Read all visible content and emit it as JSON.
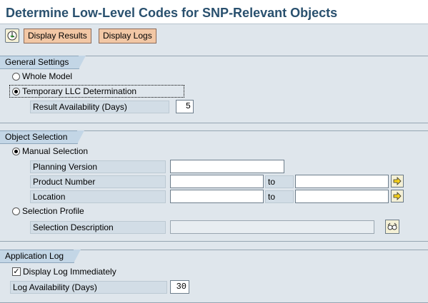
{
  "window": {
    "title": "Determine Low-Level Codes for SNP-Relevant Objects"
  },
  "toolbar": {
    "execute_icon": "execute-icon",
    "display_results": "Display Results",
    "display_logs": "Display Logs"
  },
  "general_settings": {
    "title": "General Settings",
    "whole_model": "Whole Model",
    "temporary_llc": "Temporary LLC Determination",
    "selected": "temporary_llc",
    "result_availability_label": "Result Availability (Days)",
    "result_availability_value": "5"
  },
  "object_selection": {
    "title": "Object Selection",
    "manual_selection": "Manual Selection",
    "selected": "manual_selection",
    "planning_version_label": "Planning Version",
    "planning_version_value": "",
    "product_number_label": "Product Number",
    "product_from": "",
    "product_to": "",
    "location_label": "Location",
    "location_from": "",
    "location_to": "",
    "to_label": "to",
    "selection_profile": "Selection Profile",
    "selection_description_label": "Selection Description",
    "selection_description_value": ""
  },
  "application_log": {
    "title": "Application Log",
    "display_log_immediately": "Display Log Immediately",
    "display_log_checked": true,
    "log_availability_label": "Log Availability (Days)",
    "log_availability_value": "30"
  },
  "colors": {
    "title_text": "#29506e",
    "background": "#dfe6ec",
    "button": "#f2c7a5",
    "group_header": "#c3d6e6"
  }
}
